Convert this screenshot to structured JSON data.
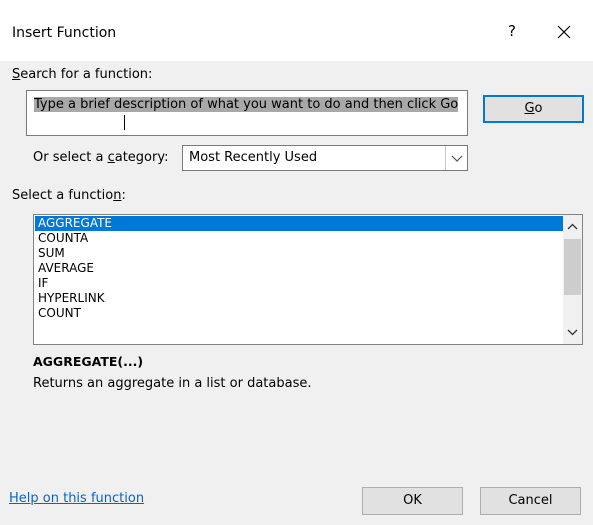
{
  "dialog": {
    "title": "Insert Function",
    "help_glyph": "?",
    "close_glyph": "✕"
  },
  "search": {
    "label_prefix": "",
    "label_access_key": "S",
    "label_rest": "earch for a function:",
    "value": "Type a brief description of what you want to do and then click Go",
    "go_label_key": "G",
    "go_label_rest": "o"
  },
  "category": {
    "label_before": "Or select a ",
    "label_access_key": "c",
    "label_after": "ategory:",
    "selected": "Most Recently Used"
  },
  "functions": {
    "label_before": "Select a functio",
    "label_access_key": "n",
    "label_after": ":",
    "items": [
      "AGGREGATE",
      "COUNTA",
      "SUM",
      "AVERAGE",
      "IF",
      "HYPERLINK",
      "COUNT"
    ],
    "selected_index": 0
  },
  "details": {
    "syntax": "AGGREGATE(...)",
    "description": "Returns an aggregate in a list or database."
  },
  "footer": {
    "help_link": "Help on this function",
    "ok_label": "OK",
    "cancel_label": "Cancel"
  },
  "colors": {
    "selection": "#0078d7",
    "link": "#0066cc",
    "search_highlight": "#a8a8a8"
  }
}
